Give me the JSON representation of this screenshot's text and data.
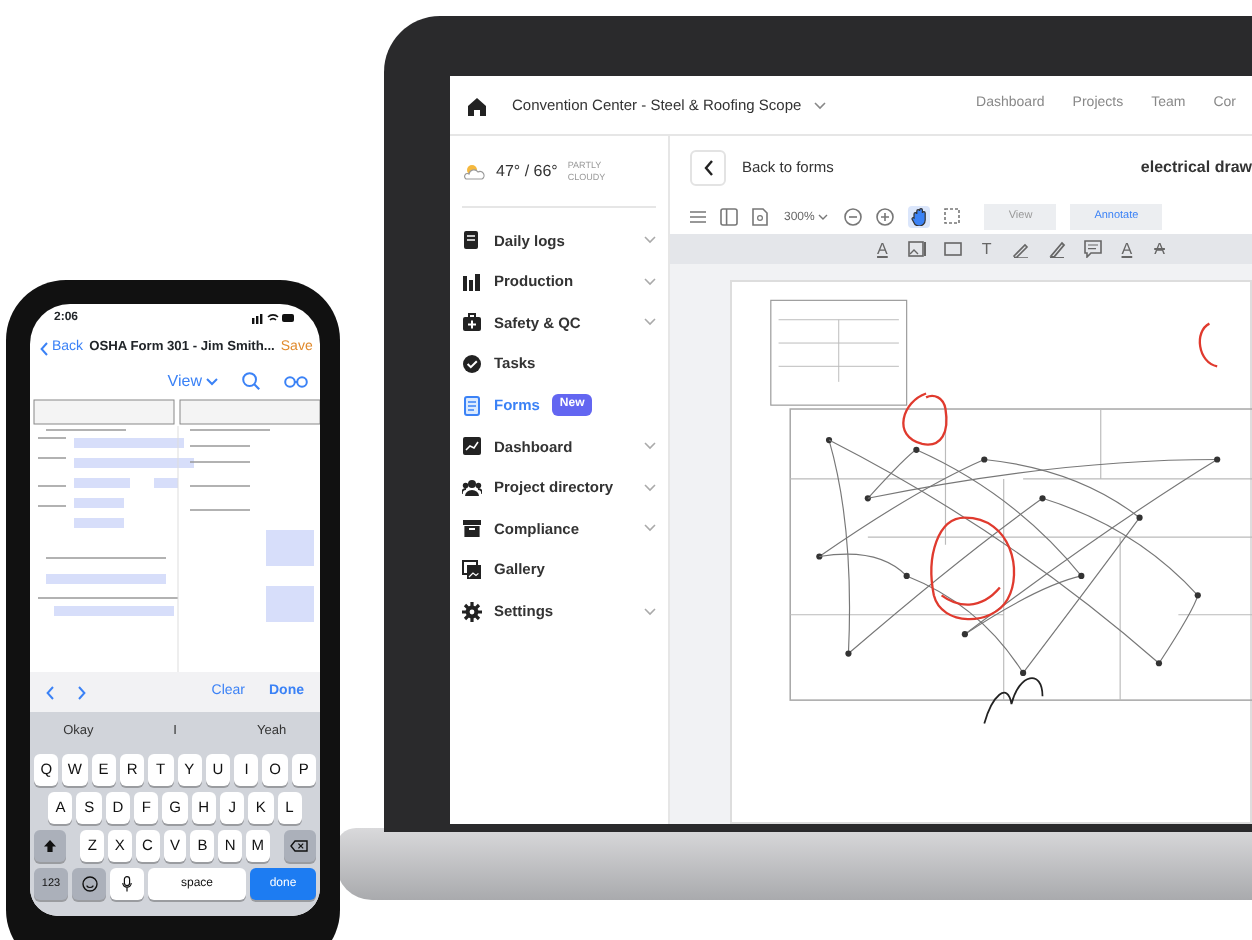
{
  "laptop": {
    "project_title": "Convention Center - Steel & Roofing Scope",
    "nav_links": [
      "Dashboard",
      "Projects",
      "Team",
      "Cor"
    ],
    "weather": {
      "temps": "47° / 66°",
      "condition": "PARTLY CLOUDY"
    },
    "sidebar": [
      {
        "label": "Daily logs",
        "expandable": true,
        "selected": false
      },
      {
        "label": "Production",
        "expandable": true,
        "selected": false
      },
      {
        "label": "Safety & QC",
        "expandable": true,
        "selected": false
      },
      {
        "label": "Tasks",
        "expandable": false,
        "selected": false
      },
      {
        "label": "Forms",
        "expandable": false,
        "selected": true,
        "badge": "New"
      },
      {
        "label": "Dashboard",
        "expandable": true,
        "selected": false
      },
      {
        "label": "Project directory",
        "expandable": true,
        "selected": false
      },
      {
        "label": "Compliance",
        "expandable": true,
        "selected": false
      },
      {
        "label": "Gallery",
        "expandable": false,
        "selected": false
      },
      {
        "label": "Settings",
        "expandable": true,
        "selected": false
      }
    ],
    "back_label": "Back to forms",
    "document_title": "electrical draw",
    "zoom": "300%",
    "pan_tool": {
      "selected": true
    },
    "modes": [
      {
        "label": "View",
        "selected": false
      },
      {
        "label": "Annotate",
        "selected": true
      }
    ],
    "annotation_tools": [
      {
        "kind": "text-color",
        "glyph": "A"
      },
      {
        "kind": "image"
      },
      {
        "kind": "rectangle"
      },
      {
        "kind": "text",
        "glyph": "T"
      },
      {
        "kind": "pen"
      },
      {
        "kind": "highlighter"
      },
      {
        "kind": "comment"
      },
      {
        "kind": "underline",
        "glyph": "A"
      },
      {
        "kind": "strikeout",
        "glyph": "A"
      }
    ]
  },
  "phone": {
    "time": "2:06",
    "back": "Back",
    "title": "OSHA Form 301 - Jim Smith...",
    "save": "Save",
    "view_menu": "View",
    "form_toolbar": {
      "clear": "Clear",
      "done": "Done"
    },
    "suggestions": [
      "Okay",
      "I",
      "Yeah"
    ],
    "keyboard": {
      "rows": [
        [
          "Q",
          "W",
          "E",
          "R",
          "T",
          "Y",
          "U",
          "I",
          "O",
          "P"
        ],
        [
          "A",
          "S",
          "D",
          "F",
          "G",
          "H",
          "J",
          "K",
          "L"
        ],
        [
          "Z",
          "X",
          "C",
          "V",
          "B",
          "N",
          "M"
        ]
      ],
      "numbers_key": "123",
      "space_key": "space",
      "return_key": "done"
    }
  }
}
